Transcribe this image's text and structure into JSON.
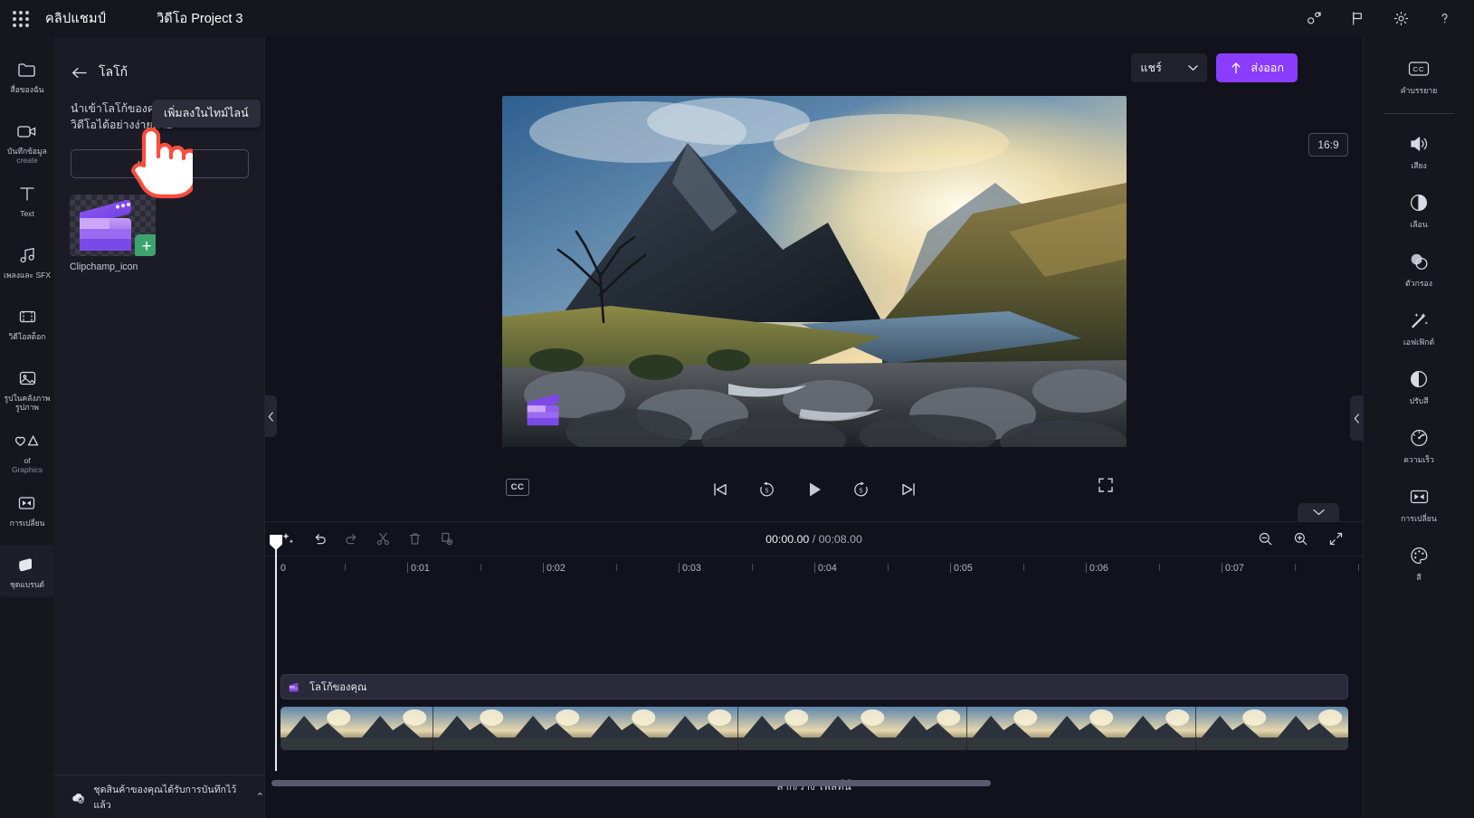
{
  "topbar": {
    "waffle_label": "app-launcher",
    "brand": "คลิปแชมป์",
    "project_title": "วิดีโอ Project 3",
    "icons": [
      {
        "name": "collaborate-icon",
        "label": "ทำงานร่วมกัน"
      },
      {
        "name": "flag-icon",
        "label": "ข้อเสนอแนะ"
      },
      {
        "name": "gear-icon",
        "label": "การตั้งค่า"
      },
      {
        "name": "help-icon",
        "label": "?"
      }
    ],
    "help_glyph": "?"
  },
  "left_rail": {
    "items": [
      {
        "name": "sidebar-item-media",
        "icon": "folder-icon",
        "label": "สื่อของฉัน",
        "label2": ""
      },
      {
        "name": "sidebar-item-record",
        "icon": "camera-icon",
        "label": "บันทึกข้อมูล",
        "label2": "create"
      },
      {
        "name": "sidebar-item-text",
        "icon": "text-icon",
        "label": "Text",
        "label2": ""
      },
      {
        "name": "sidebar-item-music-sfx",
        "icon": "music-note-icon",
        "label": "เพลงและ SFX",
        "label2": ""
      },
      {
        "name": "sidebar-item-stock-video",
        "icon": "film-strip-icon",
        "label": "วิดีโอสต็อก",
        "label2": ""
      },
      {
        "name": "sidebar-item-stock-image",
        "icon": "image-icon",
        "label": "รูปในคลังภาพรูปภาพ",
        "label2": ""
      },
      {
        "name": "sidebar-item-graphics",
        "icon": "shapes-icon",
        "label": "of",
        "label2": "Graphics"
      },
      {
        "name": "sidebar-item-transitions",
        "icon": "transition-icon",
        "label": "การเปลี่ยน",
        "label2": ""
      },
      {
        "name": "sidebar-item-brand-kit",
        "icon": "brand-kit-icon",
        "label": "ชุดแบรนด์",
        "label2": ""
      }
    ]
  },
  "panel": {
    "back_label": "ย้อนกลับ",
    "title": "โลโก้",
    "description": "นำเข้าโลโก้ของคุณเพื่อเพิ่มไปยังวิดีโอได้อย่างง่ายดาย",
    "add_button": "เพิ่มโลโก้",
    "media": {
      "name": "Clipchamp_icon",
      "plus_glyph": "+",
      "tooltip": "เพิ่มลงในไทม์ไลน์"
    },
    "footer": {
      "text": "ชุดสินค้าของคุณได้รับการบันทึกไว้แล้ว",
      "chevron": "⌃"
    }
  },
  "stage": {
    "share_button": "แชร์",
    "export_button": "ส่งออก",
    "aspect_ratio": "16:9",
    "cc_button": "CC",
    "transport": [
      {
        "name": "skip-back-icon",
        "label": "ย้อนกลับ"
      },
      {
        "name": "rewind-5-icon",
        "label": "5"
      },
      {
        "name": "play-icon",
        "label": "เล่น"
      },
      {
        "name": "forward-5-icon",
        "label": "5"
      },
      {
        "name": "skip-forward-icon",
        "label": "ถัดไป"
      }
    ],
    "fullscreen_label": "เต็มหน้าจอ"
  },
  "timeline": {
    "toolbar": [
      {
        "name": "magic-wand-button",
        "label": "ปรับแต่งอัตโนมัติ",
        "disabled": false
      },
      {
        "name": "undo-button",
        "label": "เลิกทำ",
        "disabled": false
      },
      {
        "name": "redo-button",
        "label": "ทำซ้ำ",
        "disabled": true
      },
      {
        "name": "split-button",
        "label": "แยก",
        "disabled": true
      },
      {
        "name": "delete-button",
        "label": "ลบ",
        "disabled": true
      },
      {
        "name": "duplicate-button",
        "label": "ทำสำเนา",
        "disabled": true
      }
    ],
    "current_time": "00:00.00",
    "separator": " / ",
    "total_time": "00:08.00",
    "zoom_out_label": "ซูมออก",
    "zoom_in_label": "ซูมเข้า",
    "fit_label": "พอดี",
    "ruler_ticks": [
      "0",
      "0:01",
      "0:02",
      "0:03",
      "0:04",
      "0:05",
      "0:06",
      "0:07"
    ],
    "clip_logo_name": "โลโก้ของคุณ",
    "drop_hint": "ลาก/วาง ไฟล์ที่นี่"
  },
  "right_rail": {
    "items": [
      {
        "name": "panel-item-captions",
        "icon": "cc-icon",
        "label": "คำบรรยาย",
        "divider": true
      },
      {
        "name": "panel-item-audio",
        "icon": "speaker-icon",
        "label": "เสียง",
        "divider": false
      },
      {
        "name": "panel-item-fade",
        "icon": "fade-icon",
        "label": "เลือน",
        "divider": false
      },
      {
        "name": "panel-item-filters",
        "icon": "filters-icon",
        "label": "ตัวกรอง",
        "divider": false
      },
      {
        "name": "panel-item-effects",
        "icon": "sparkle-wand-icon",
        "label": "เอฟเฟิกต์",
        "divider": false
      },
      {
        "name": "panel-item-adjust-color",
        "icon": "contrast-icon",
        "label": "ปรับสี",
        "divider": false
      },
      {
        "name": "panel-item-speed",
        "icon": "speedometer-icon",
        "label": "ความเร็ว",
        "divider": false
      },
      {
        "name": "panel-item-transition",
        "icon": "transition-icon",
        "label": "การเปลี่ยน",
        "divider": false
      },
      {
        "name": "panel-item-color",
        "icon": "palette-icon",
        "label": "สี",
        "divider": false
      }
    ]
  },
  "colors": {
    "accent": "#8b3dff",
    "panel_bg": "#1b1b26",
    "app_bg": "#12121c",
    "rail_bg": "#16161f",
    "plus_green": "#3da36e"
  }
}
